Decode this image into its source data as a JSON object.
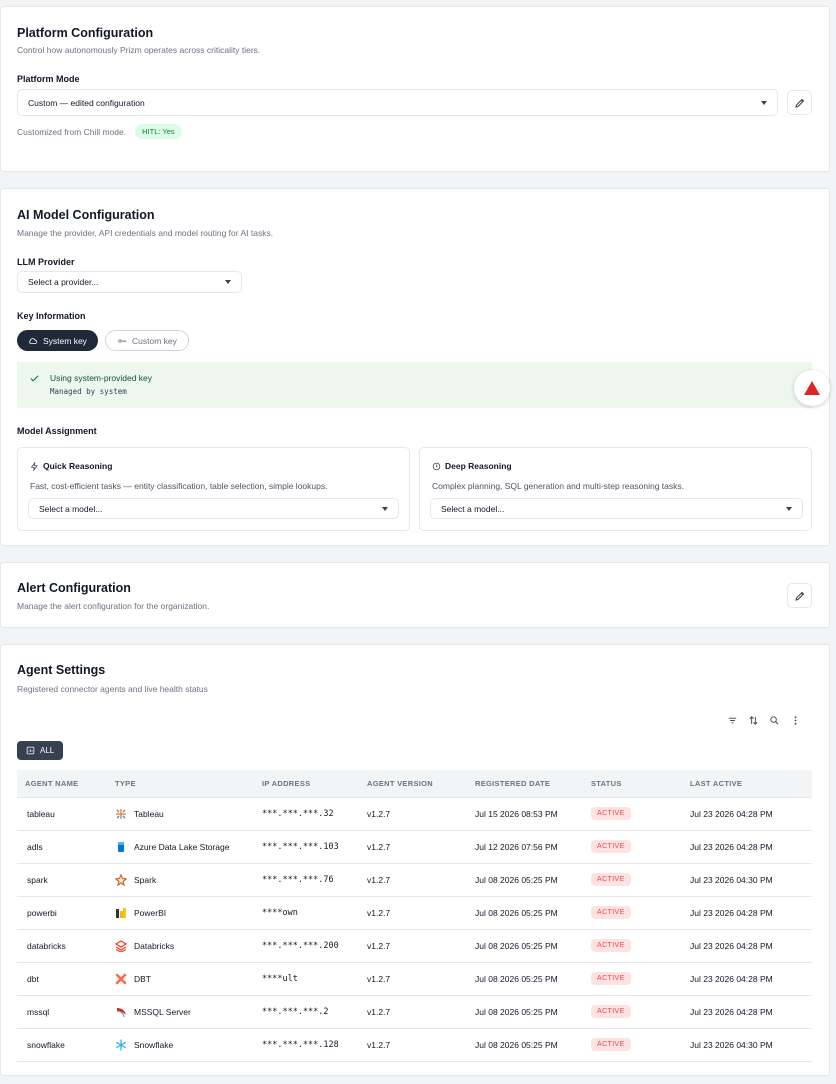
{
  "platform": {
    "title": "Platform Configuration",
    "description": "Control how autonomously Prizm operates across criticality tiers.",
    "mode_label": "Platform Mode",
    "mode_value": "Custom — edited configuration",
    "customized_note": "Customized from Chill mode.",
    "hitl_badge": "HITL: Yes"
  },
  "ai_model": {
    "title": "AI Model Configuration",
    "description": "Manage the provider, API credentials and model routing for AI tasks.",
    "provider_label": "LLM Provider",
    "provider_placeholder": "Select a provider...",
    "key_info_label": "Key Information",
    "system_key_label": "System key",
    "custom_key_label": "Custom key",
    "banner_title": "Using system-provided key",
    "banner_subtitle": "Managed by system",
    "assignment_label": "Model Assignment",
    "quick": {
      "title": "Quick Reasoning",
      "description": "Fast, cost-efficient tasks — entity classification, table selection, simple lookups.",
      "placeholder": "Select a model..."
    },
    "deep": {
      "title": "Deep Reasoning",
      "description": "Complex planning, SQL generation and multi-step reasoning tasks.",
      "placeholder": "Select a model..."
    }
  },
  "alert": {
    "title": "Alert Configuration",
    "description": "Manage the alert configuration for the organization."
  },
  "agents": {
    "title": "Agent Settings",
    "description": "Registered connector agents and live health status",
    "filter_all": "ALL",
    "columns": [
      "AGENT NAME",
      "TYPE",
      "IP ADDRESS",
      "AGENT VERSION",
      "REGISTERED DATE",
      "STATUS",
      "LAST ACTIVE"
    ],
    "rows": [
      {
        "name": "tableau",
        "type": "Tableau",
        "icon": "tableau-icon",
        "ip": "***.***.***.32",
        "version": "v1.2.7",
        "registered": "Jul 15 2026 08:53 PM",
        "status": "ACTIVE",
        "last_active": "Jul 23 2026 04:28 PM"
      },
      {
        "name": "adls",
        "type": "Azure Data Lake Storage",
        "icon": "adls-icon",
        "ip": "***.***.***.103",
        "version": "v1.2.7",
        "registered": "Jul 12 2026 07:56 PM",
        "status": "ACTIVE",
        "last_active": "Jul 23 2026 04:28 PM"
      },
      {
        "name": "spark",
        "type": "Spark",
        "icon": "spark-icon",
        "ip": "***.***.***.76",
        "version": "v1.2.7",
        "registered": "Jul 08 2026 05:25 PM",
        "status": "ACTIVE",
        "last_active": "Jul 23 2026 04:30 PM"
      },
      {
        "name": "powerbi",
        "type": "PowerBI",
        "icon": "powerbi-icon",
        "ip": "****own",
        "version": "v1.2.7",
        "registered": "Jul 08 2026 05:25 PM",
        "status": "ACTIVE",
        "last_active": "Jul 23 2026 04:28 PM"
      },
      {
        "name": "databricks",
        "type": "Databricks",
        "icon": "databricks-icon",
        "ip": "***.***.***.200",
        "version": "v1.2.7",
        "registered": "Jul 08 2026 05:25 PM",
        "status": "ACTIVE",
        "last_active": "Jul 23 2026 04:28 PM"
      },
      {
        "name": "dbt",
        "type": "DBT",
        "icon": "dbt-icon",
        "ip": "****ult",
        "version": "v1.2.7",
        "registered": "Jul 08 2026 05:25 PM",
        "status": "ACTIVE",
        "last_active": "Jul 23 2026 04:28 PM"
      },
      {
        "name": "mssql",
        "type": "MSSQL Server",
        "icon": "mssql-icon",
        "ip": "***.***.***.2",
        "version": "v1.2.7",
        "registered": "Jul 08 2026 05:25 PM",
        "status": "ACTIVE",
        "last_active": "Jul 23 2026 04:28 PM"
      },
      {
        "name": "snowflake",
        "type": "Snowflake",
        "icon": "snowflake-icon",
        "ip": "***.***.***.128",
        "version": "v1.2.7",
        "registered": "Jul 08 2026 05:25 PM",
        "status": "ACTIVE",
        "last_active": "Jul 23 2026 04:30 PM"
      }
    ]
  },
  "colors": {
    "accent_dark": "#1f2937",
    "status_red": "#ef4444",
    "success_green": "#15803d",
    "alert_red": "#dc2626"
  }
}
